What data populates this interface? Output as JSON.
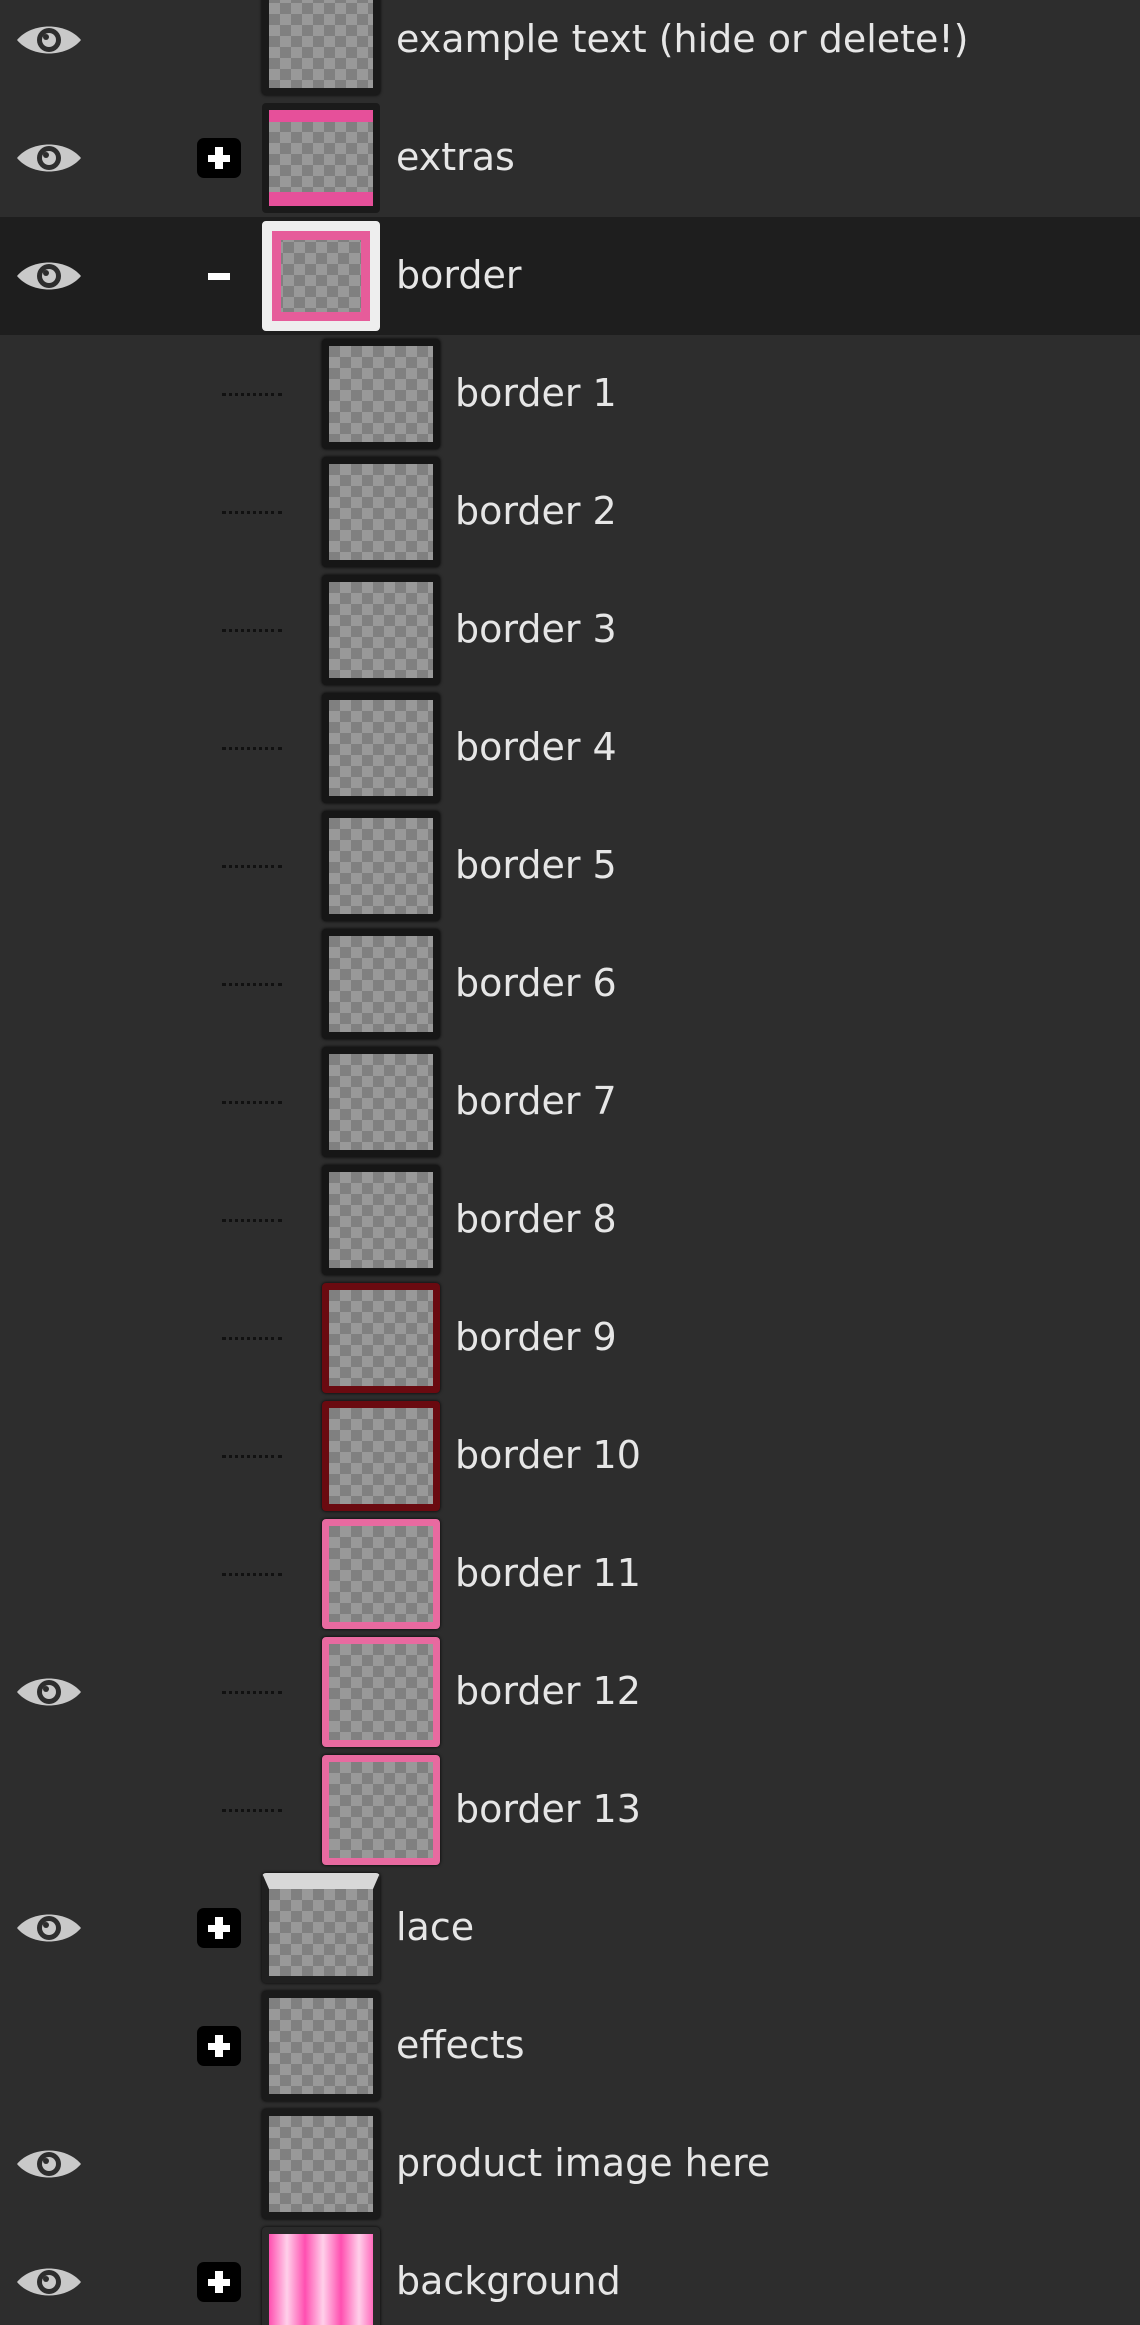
{
  "layers": [
    {
      "label": "example text (hide or delete!)",
      "visible": true,
      "expander": "none",
      "thumb": "plain",
      "level": 0,
      "selected": false
    },
    {
      "label": "extras",
      "visible": true,
      "expander": "plus",
      "thumb": "extras",
      "level": 0,
      "selected": false
    },
    {
      "label": "border",
      "visible": true,
      "expander": "minus",
      "thumb": "sel",
      "level": 0,
      "selected": true
    },
    {
      "label": "border 1",
      "visible": false,
      "expander": "none",
      "thumb": "dark",
      "level": 1,
      "selected": false
    },
    {
      "label": "border 2",
      "visible": false,
      "expander": "none",
      "thumb": "dark",
      "level": 1,
      "selected": false
    },
    {
      "label": "border 3",
      "visible": false,
      "expander": "none",
      "thumb": "dark",
      "level": 1,
      "selected": false
    },
    {
      "label": "border 4",
      "visible": false,
      "expander": "none",
      "thumb": "dark",
      "level": 1,
      "selected": false
    },
    {
      "label": "border 5",
      "visible": false,
      "expander": "none",
      "thumb": "dark",
      "level": 1,
      "selected": false
    },
    {
      "label": "border 6",
      "visible": false,
      "expander": "none",
      "thumb": "dark",
      "level": 1,
      "selected": false
    },
    {
      "label": "border 7",
      "visible": false,
      "expander": "none",
      "thumb": "dark",
      "level": 1,
      "selected": false
    },
    {
      "label": "border 8",
      "visible": false,
      "expander": "none",
      "thumb": "dark",
      "level": 1,
      "selected": false
    },
    {
      "label": "border 9",
      "visible": false,
      "expander": "none",
      "thumb": "red",
      "level": 1,
      "selected": false
    },
    {
      "label": "border 10",
      "visible": false,
      "expander": "none",
      "thumb": "red",
      "level": 1,
      "selected": false
    },
    {
      "label": "border 11",
      "visible": false,
      "expander": "none",
      "thumb": "pink",
      "level": 1,
      "selected": false
    },
    {
      "label": "border 12",
      "visible": true,
      "expander": "none",
      "thumb": "pink",
      "level": 1,
      "selected": false
    },
    {
      "label": "border 13",
      "visible": false,
      "expander": "none",
      "thumb": "pink",
      "level": 1,
      "selected": false
    },
    {
      "label": "lace",
      "visible": true,
      "expander": "plus",
      "thumb": "lace",
      "level": 0,
      "selected": false
    },
    {
      "label": "effects",
      "visible": false,
      "expander": "plus",
      "thumb": "plain",
      "level": 0,
      "selected": false
    },
    {
      "label": "product image here",
      "visible": true,
      "expander": "none",
      "thumb": "plain",
      "level": 0,
      "selected": false
    },
    {
      "label": "background",
      "visible": true,
      "expander": "plus",
      "thumb": "bg",
      "level": 0,
      "selected": false
    }
  ],
  "icons": {
    "visibility": "eye-icon",
    "expand": "plus-icon",
    "collapse": "minus-icon"
  },
  "colors": {
    "panel_bg": "#2d2d2d",
    "selected_row_bg": "#1e1e1e",
    "text": "#e6e6e6",
    "accent_pink": "#e86aa0"
  }
}
